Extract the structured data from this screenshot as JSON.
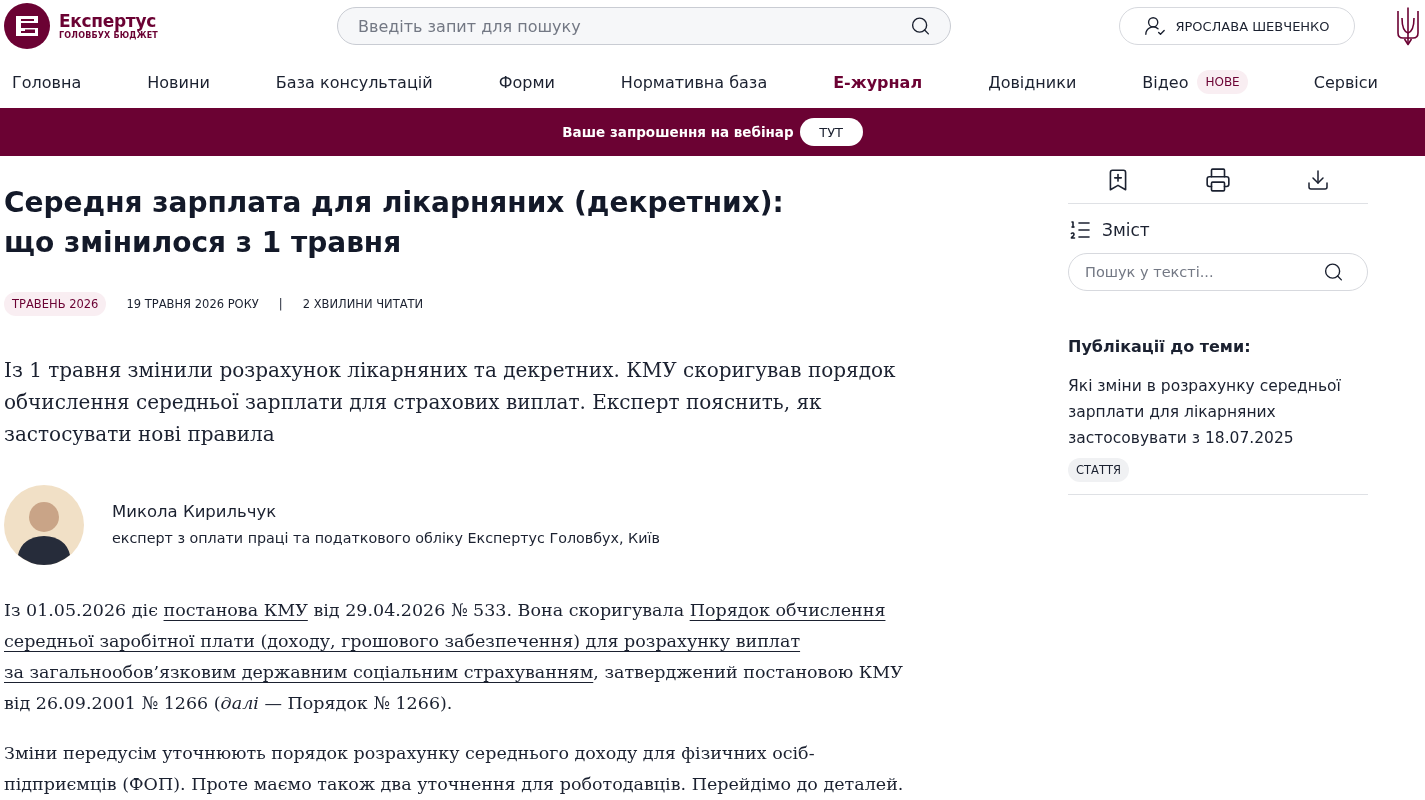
{
  "header": {
    "brand": {
      "name": "Експертус",
      "tagline": "ГОЛОВБУХ БЮДЖЕТ"
    },
    "search": {
      "placeholder": "Введіть запит для пошуку"
    },
    "user": {
      "name": "ЯРОСЛАВА ШЕВЧЕНКО"
    }
  },
  "nav": [
    {
      "label": "Головна",
      "selected": false
    },
    {
      "label": "Новини",
      "selected": false
    },
    {
      "label": "База консультацій",
      "selected": false
    },
    {
      "label": "Форми",
      "selected": false
    },
    {
      "label": "Нормативна база",
      "selected": false
    },
    {
      "label": "Е-журнал",
      "selected": true
    },
    {
      "label": "Довідники",
      "selected": false
    },
    {
      "label": "Відео",
      "selected": false,
      "badge": "НОВЕ"
    },
    {
      "label": "Сервіси",
      "selected": false
    }
  ],
  "banner": {
    "text": "Ваше запрошення на вебінар",
    "button": "ТУТ"
  },
  "article": {
    "title": "Середня зарплата для лікарняних (декретних): що змінилося з 1 травня",
    "issue_tag": "ТРАВЕНЬ 2026",
    "date": "19 ТРАВНЯ 2026 РОКУ",
    "separator": "|",
    "read_time": "2 ХВИЛИНИ ЧИТАТИ",
    "lead": "Із 1 травня змінили розрахунок лікарняних та декретних. КМУ скоригував порядок обчислення середньої зарплати для страхових виплат. Експерт пояснить, як застосувати нові правила",
    "author": {
      "name": "Микола Кирильчук",
      "role": "експерт з оплати праці та податкового обліку Експертус Головбух, Київ"
    },
    "paragraphs": [
      {
        "segments": [
          {
            "kind": "text",
            "text": "Із 01.05.2026 діє "
          },
          {
            "kind": "link",
            "text": "постанова КМУ"
          },
          {
            "kind": "text",
            "text": " від 29.04.2026 № 533. Вона скоригувала "
          },
          {
            "kind": "link",
            "text": "Порядок обчислення"
          },
          {
            "kind": "link",
            "text": "середньої заробітної плати (доходу, грошового забезпечення) для розрахунку виплат"
          },
          {
            "kind": "link",
            "text": "за загальнообов’язковим державним соціальним страхуванням"
          },
          {
            "kind": "text",
            "text": ", затверджений постановою КМУ від 26.09.2001 № 1266 (*далі* — Порядок № 1266)."
          }
        ]
      },
      {
        "segments": [
          {
            "kind": "text",
            "text": "Зміни передусім уточнюють порядок розрахунку середнього доходу для фізичних осіб-підприємців (ФОП). Проте маємо також два уточнення для роботодавців. Перейдімо до деталей."
          }
        ]
      }
    ]
  },
  "sidebar": {
    "contents": "Зміст",
    "search": {
      "placeholder": "Пошук у тексті..."
    },
    "related": {
      "heading": "Публікації до теми:",
      "items": [
        {
          "title": "Які зміни в розрахунку середньої зарплати для лікарняних застосовувати з 18.07.2025",
          "tag": "СТАТТЯ"
        }
      ]
    }
  }
}
